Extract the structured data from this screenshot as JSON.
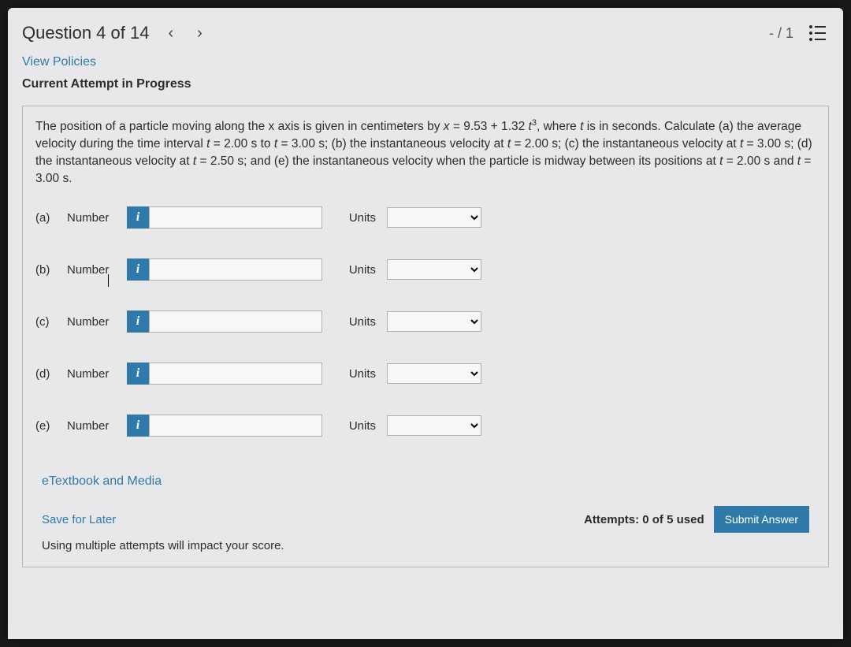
{
  "header": {
    "title": "Question 4 of 14",
    "score": "- / 1"
  },
  "links": {
    "view_policies": "View Policies",
    "etextbook": "eTextbook and Media",
    "save_later": "Save for Later"
  },
  "attempt_label": "Current Attempt in Progress",
  "question_text_parts": {
    "p1": "The position of a particle moving along the x axis is given in centimeters by ",
    "eq1_a": "x",
    "eq1_b": " = 9.53 + 1.32 ",
    "eq1_c": "t",
    "eq1_sup": "3",
    "p2": ", where ",
    "eq2": "t",
    "p3": " is in seconds. Calculate (a) the average velocity during the time interval ",
    "eq3": "t",
    "p4": " = 2.00 s to ",
    "eq4": "t",
    "p5": " = 3.00 s; (b) the instantaneous velocity at ",
    "eq5": "t",
    "p6": " = 2.00 s; (c) the instantaneous velocity at ",
    "eq6": "t",
    "p7": " = 3.00 s; (d) the instantaneous velocity at ",
    "eq7": "t",
    "p8": " = 2.50 s; and (e) the instantaneous velocity when the particle is midway between its positions at ",
    "eq8": "t",
    "p9": " = 2.00 s and ",
    "eq9": "t",
    "p10": " = 3.00 s."
  },
  "parts": [
    {
      "label": "(a)",
      "number_label": "Number",
      "units_label": "Units",
      "value": "",
      "units": ""
    },
    {
      "label": "(b)",
      "number_label": "Number",
      "units_label": "Units",
      "value": "",
      "units": ""
    },
    {
      "label": "(c)",
      "number_label": "Number",
      "units_label": "Units",
      "value": "",
      "units": ""
    },
    {
      "label": "(d)",
      "number_label": "Number",
      "units_label": "Units",
      "value": "",
      "units": ""
    },
    {
      "label": "(e)",
      "number_label": "Number",
      "units_label": "Units",
      "value": "",
      "units": ""
    }
  ],
  "info_icon_glyph": "i",
  "footer": {
    "attempts": "Attempts: 0 of 5 used",
    "submit": "Submit Answer",
    "impact": "Using multiple attempts will impact your score."
  }
}
